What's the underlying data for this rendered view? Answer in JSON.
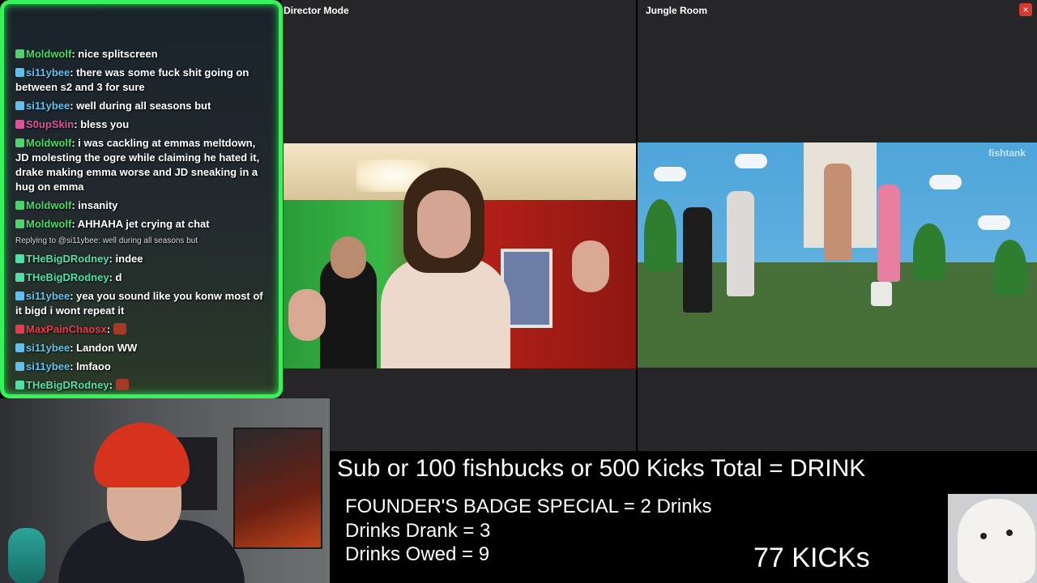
{
  "director": {
    "title": "Director Mode"
  },
  "jungle": {
    "title": "Jungle Room",
    "close_label": "×",
    "watermark": "fishtank"
  },
  "chat": {
    "lines": [
      {
        "user": "Moldwolf",
        "color": "#4ad66b",
        "text": "nice splitscreen"
      },
      {
        "user": "si11ybee",
        "color": "#5fc0f0",
        "text": "there was some fuck shit going on between s2 and 3 for sure"
      },
      {
        "user": "si11ybee",
        "color": "#5fc0f0",
        "text": "well during all seasons but"
      },
      {
        "user": "S0upSkin",
        "color": "#e0509a",
        "text": "bless you"
      },
      {
        "user": "Moldwolf",
        "color": "#4ad66b",
        "text": "i was cackling at emmas meltdown, JD molesting the ogre while claiming he hated it, drake making emma worse and JD sneaking in a hug on emma"
      },
      {
        "user": "Moldwolf",
        "color": "#4ad66b",
        "text": "insanity"
      },
      {
        "user": "Moldwolf",
        "color": "#4ad66b",
        "text": "AHHAHA jet crying at chat"
      },
      {
        "reply": "Replying to @si11ybee: well during all seasons but"
      },
      {
        "user": "THeBigDRodney",
        "color": "#4fe0a8",
        "text": "indee"
      },
      {
        "user": "THeBigDRodney",
        "color": "#4fe0a8",
        "text": "d"
      },
      {
        "user": "si11ybee",
        "color": "#5fc0f0",
        "text": "yea you sound like you konw most of it bigd i wont repeat it"
      },
      {
        "user": "MaxPainChaosx",
        "color": "#e83a4c",
        "text": ""
      },
      {
        "user": "si11ybee",
        "color": "#5fc0f0",
        "text": "Landon WW"
      },
      {
        "user": "si11ybee",
        "color": "#5fc0f0",
        "text": "lmfaoo"
      },
      {
        "user": "THeBigDRodney",
        "color": "#4fe0a8",
        "text": ""
      }
    ]
  },
  "overlay": {
    "headline": "Sub or 100 fishbucks or 500 Kicks Total = DRINK",
    "founders": "FOUNDER'S BADGE SPECIAL = 2 Drinks",
    "drank": "Drinks Drank = 3",
    "owed": "Drinks Owed = 9",
    "kicks": "77 KICKs"
  },
  "colors": {
    "chat_border": "#36f35c",
    "panel_bg": "#262629",
    "close": "#d63a2f"
  }
}
